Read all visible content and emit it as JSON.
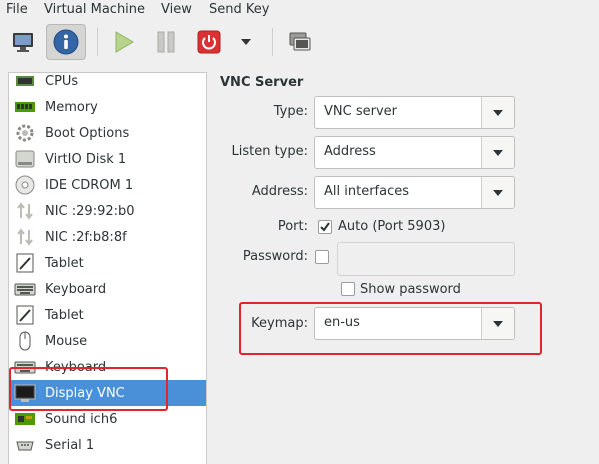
{
  "menubar": {
    "items": [
      "File",
      "Virtual Machine",
      "View",
      "Send Key"
    ]
  },
  "toolbar": {
    "buttons": [
      "console-icon",
      "info-icon",
      "run-icon",
      "pause-icon",
      "shutdown-icon",
      "shutdown-menu-icon",
      "screenshot-icon"
    ],
    "active": "info-icon"
  },
  "sidebar": {
    "items": [
      {
        "label": "CPUs",
        "icon": "cpu-icon"
      },
      {
        "label": "Memory",
        "icon": "memory-icon"
      },
      {
        "label": "Boot Options",
        "icon": "boot-icon"
      },
      {
        "label": "VirtIO Disk 1",
        "icon": "disk-icon"
      },
      {
        "label": "IDE CDROM 1",
        "icon": "cdrom-icon"
      },
      {
        "label": "NIC :29:92:b0",
        "icon": "nic-icon"
      },
      {
        "label": "NIC :2f:b8:8f",
        "icon": "nic-icon"
      },
      {
        "label": "Tablet",
        "icon": "tablet-icon"
      },
      {
        "label": "Keyboard",
        "icon": "keyboard-icon"
      },
      {
        "label": "Tablet",
        "icon": "tablet-icon"
      },
      {
        "label": "Mouse",
        "icon": "mouse-icon"
      },
      {
        "label": "Keyboard",
        "icon": "keyboard-icon"
      },
      {
        "label": "Display VNC",
        "icon": "display-icon"
      },
      {
        "label": "Sound ich6",
        "icon": "sound-icon"
      },
      {
        "label": "Serial 1",
        "icon": "serial-icon"
      }
    ],
    "selected": "Display VNC"
  },
  "vnc": {
    "section_title": "VNC Server",
    "type_label": "Type:",
    "type_value": "VNC server",
    "listen_label": "Listen type:",
    "listen_value": "Address",
    "address_label": "Address:",
    "address_value": "All interfaces",
    "port_label": "Port:",
    "port_auto_label": "Auto (Port 5903)",
    "port_auto_checked": true,
    "password_label": "Password:",
    "password_checked": false,
    "password_value": "",
    "show_password_label": "Show password",
    "show_password_checked": false,
    "keymap_label": "Keymap:",
    "keymap_value": "en-us"
  },
  "colors": {
    "selection": "#4a90d9",
    "highlight": "#e0262b",
    "window_bg": "#efefef"
  }
}
